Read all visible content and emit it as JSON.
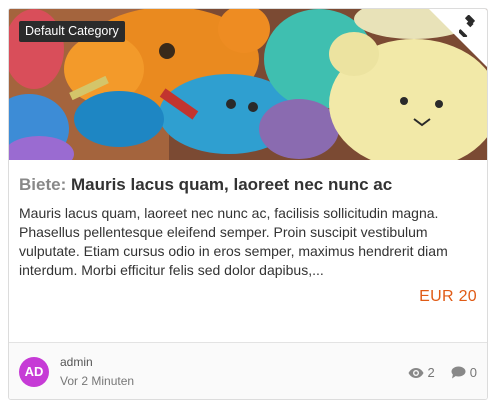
{
  "card": {
    "category": "Default Category",
    "badge_icon": "gavel-icon",
    "title_prefix": "Biete:",
    "title": "Mauris lacus quam, laoreet nec nunc ac",
    "description": "Mauris lacus quam, laoreet nec nunc ac, facilisis sollicitudin magna. Phasellus pellentesque eleifend semper. Proin suscipit vestibulum vulputate. Etiam cursus odio in eros semper, maximus hendrerit diam interdum. Morbi efficitur felis sed dolor dapibus,...",
    "price": "EUR 20",
    "price_color": "#e05b16"
  },
  "author": {
    "initials": "AD",
    "avatar_color": "#c63bd6",
    "name": "admin",
    "time": "Vor 2 Minuten"
  },
  "stats": {
    "views": "2",
    "comments": "0"
  }
}
